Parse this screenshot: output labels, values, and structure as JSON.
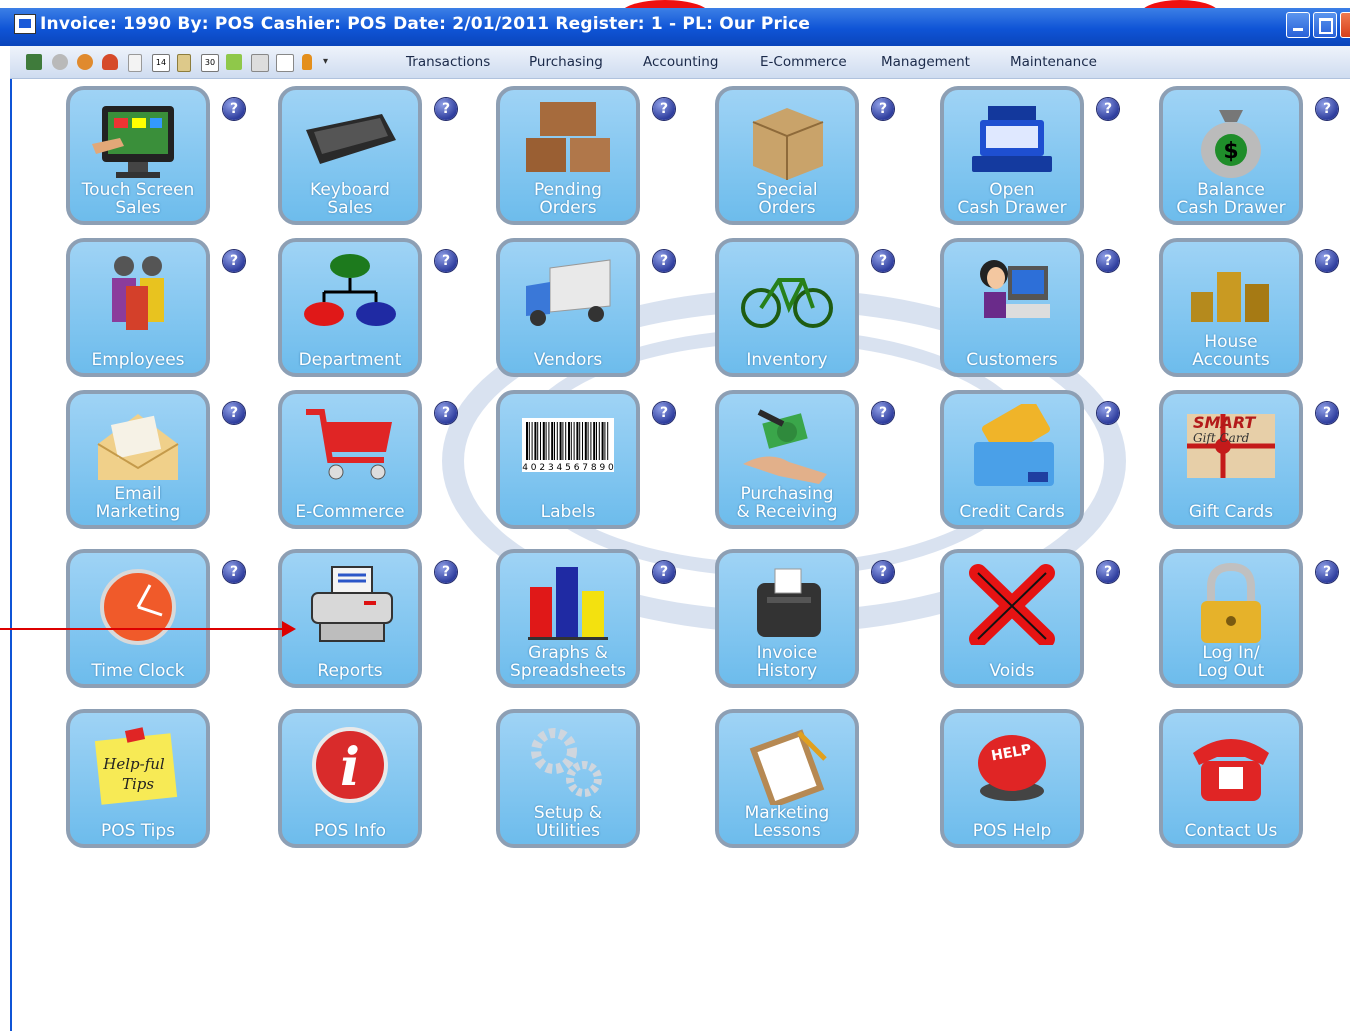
{
  "window": {
    "title": "Invoice: 1990  By: POS  Cashier: POS   Date:  2/01/2011  Register: 1  - PL: Our Price"
  },
  "menu": {
    "items": [
      "Transactions",
      "Purchasing",
      "Accounting",
      "E-Commerce",
      "Management",
      "Maintenance"
    ],
    "toolbar_icons": [
      "inventory-icon",
      "gear-icon",
      "customers-icon",
      "employee-icon",
      "document-icon",
      "calendar-14-icon",
      "list-icon",
      "calendar-30-icon",
      "mail-icon",
      "register-icon",
      "window-icon",
      "lock-icon",
      "dropdown-icon"
    ]
  },
  "tiles": [
    {
      "lines": [
        "Touch Screen",
        "Sales"
      ],
      "icon": "touch-screen-icon"
    },
    {
      "lines": [
        "Keyboard",
        "Sales"
      ],
      "icon": "keyboard-icon"
    },
    {
      "lines": [
        "Pending",
        "Orders"
      ],
      "icon": "boxes-icon"
    },
    {
      "lines": [
        "Special",
        "Orders"
      ],
      "icon": "package-icon"
    },
    {
      "lines": [
        "Open",
        "Cash Drawer"
      ],
      "icon": "cash-register-icon"
    },
    {
      "lines": [
        "Balance",
        "Cash Drawer"
      ],
      "icon": "money-bag-icon"
    },
    {
      "lines": [
        "Employees"
      ],
      "icon": "people-icon"
    },
    {
      "lines": [
        "Department"
      ],
      "icon": "org-chart-icon"
    },
    {
      "lines": [
        "Vendors"
      ],
      "icon": "truck-icon"
    },
    {
      "lines": [
        "Inventory"
      ],
      "icon": "bicycle-icon"
    },
    {
      "lines": [
        "Customers"
      ],
      "icon": "customer-computer-icon"
    },
    {
      "lines": [
        "House",
        "Accounts"
      ],
      "icon": "coins-icon"
    },
    {
      "lines": [
        "Email",
        "Marketing"
      ],
      "icon": "envelope-icon"
    },
    {
      "lines": [
        "E-Commerce"
      ],
      "icon": "shopping-cart-icon"
    },
    {
      "lines": [
        "Labels"
      ],
      "icon": "barcode-icon",
      "barcode_text": "4 0 2 3 4 5 6 7 8 9 0"
    },
    {
      "lines": [
        "Purchasing",
        "& Receiving"
      ],
      "icon": "money-exchange-icon"
    },
    {
      "lines": [
        "Credit Cards"
      ],
      "icon": "credit-cards-icon"
    },
    {
      "lines": [
        "Gift Cards"
      ],
      "icon": "gift-card-icon",
      "card_text": [
        "SMART",
        "Gift Card"
      ]
    },
    {
      "lines": [
        "Time Clock"
      ],
      "icon": "clock-icon"
    },
    {
      "lines": [
        "Reports"
      ],
      "icon": "printer-icon"
    },
    {
      "lines": [
        "Graphs &",
        "Spreadsheets"
      ],
      "icon": "bar-graph-icon"
    },
    {
      "lines": [
        "Invoice",
        "History"
      ],
      "icon": "receipt-printer-icon"
    },
    {
      "lines": [
        "Voids"
      ],
      "icon": "x-icon"
    },
    {
      "lines": [
        "Log In/",
        "Log Out"
      ],
      "icon": "padlock-icon"
    },
    {
      "lines": [
        "POS Tips"
      ],
      "icon": "sticky-note-icon",
      "note_text": [
        "Help-ful",
        "Tips"
      ]
    },
    {
      "lines": [
        "POS Info"
      ],
      "icon": "info-icon",
      "badge_text": "i"
    },
    {
      "lines": [
        "Setup &",
        "Utilities"
      ],
      "icon": "gears-icon"
    },
    {
      "lines": [
        "Marketing",
        "Lessons"
      ],
      "icon": "clipboard-icon"
    },
    {
      "lines": [
        "POS Help"
      ],
      "icon": "help-button-icon",
      "badge_text": "HELP"
    },
    {
      "lines": [
        "Contact Us"
      ],
      "icon": "telephone-icon"
    }
  ],
  "help_glyph": "?",
  "colors": {
    "titlebar": "#0f54d6",
    "tile_fill": "#7fc4ee",
    "tile_border": "#8d9fb4",
    "help_button": "#2f3e9e",
    "annotation_arrow": "#dd0000"
  }
}
